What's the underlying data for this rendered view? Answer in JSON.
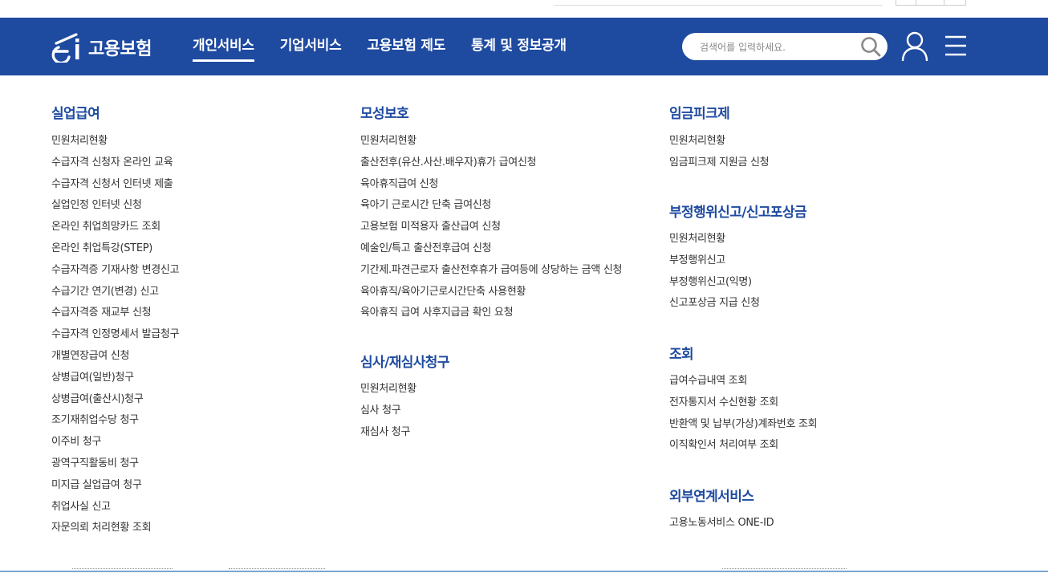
{
  "header": {
    "logo_text": "고용보험",
    "nav": [
      "개인서비스",
      "기업서비스",
      "고용보험 제도",
      "통계 및 정보공개"
    ],
    "active_nav_index": 0,
    "search_placeholder": "검색어를 입력하세요.",
    "icons": {
      "logo": "ei-logo-icon",
      "search": "search-icon",
      "user": "user-icon",
      "menu": "hamburger-menu-icon"
    }
  },
  "colors": {
    "brand": "#1e4aa0",
    "group_title": "#1e4aa0",
    "link": "#333333"
  },
  "menu": {
    "col1": [
      {
        "title": "실업급여",
        "items": [
          "민원처리현황",
          "수급자격 신청자 온라인 교육",
          "수급자격 신청서 인터넷 제출",
          "실업인정 인터넷 신청",
          "온라인 취업희망카드 조회",
          "온라인 취업특강(STEP)",
          "수급자격증 기재사항 변경신고",
          "수급기간 연기(변경) 신고",
          "수급자격증 재교부 신청",
          "수급자격 인정명세서 발급청구",
          "개별연장급여 신청",
          "상병급여(일반)청구",
          "상병급여(출산시)청구",
          "조기재취업수당 청구",
          "이주비 청구",
          "광역구직활동비 청구",
          "미지급 실업급여 청구",
          "취업사실 신고",
          "자문의뢰 처리현황 조회"
        ]
      }
    ],
    "col2": [
      {
        "title": "모성보호",
        "items": [
          "민원처리현황",
          "출산전후(유산.사산.배우자)휴가 급여신청",
          "육아휴직급여 신청",
          "육아기 근로시간 단축 급여신청",
          "고용보험 미적용자 출산급여 신청",
          "예술인/특고 출산전후급여 신청",
          "기간제.파견근로자 출산전후휴가 급여등에 상당하는 금액 신청",
          "육아휴직/육아기근로시간단축 사용현황",
          "육아휴직 급여 사후지급금 확인 요청"
        ]
      },
      {
        "title": "심사/재심사청구",
        "items": [
          "민원처리현황",
          "심사 청구",
          "재심사 청구"
        ]
      }
    ],
    "col3": [
      {
        "title": "임금피크제",
        "items": [
          "민원처리현황",
          "임금피크제 지원금 신청"
        ]
      },
      {
        "title": "부정행위신고/신고포상금",
        "items": [
          "민원처리현황",
          "부정행위신고",
          "부정행위신고(익명)",
          "신고포상금 지급 신청"
        ]
      },
      {
        "title": "조회",
        "items": [
          "급여수급내역 조회",
          "전자통지서 수신현황 조회",
          "반환액 및 납부(가상)계좌번호 조회",
          "이직확인서 처리여부 조회"
        ]
      },
      {
        "title": "외부연계서비스",
        "items": [
          "고용노동서비스 ONE-ID"
        ]
      }
    ]
  }
}
